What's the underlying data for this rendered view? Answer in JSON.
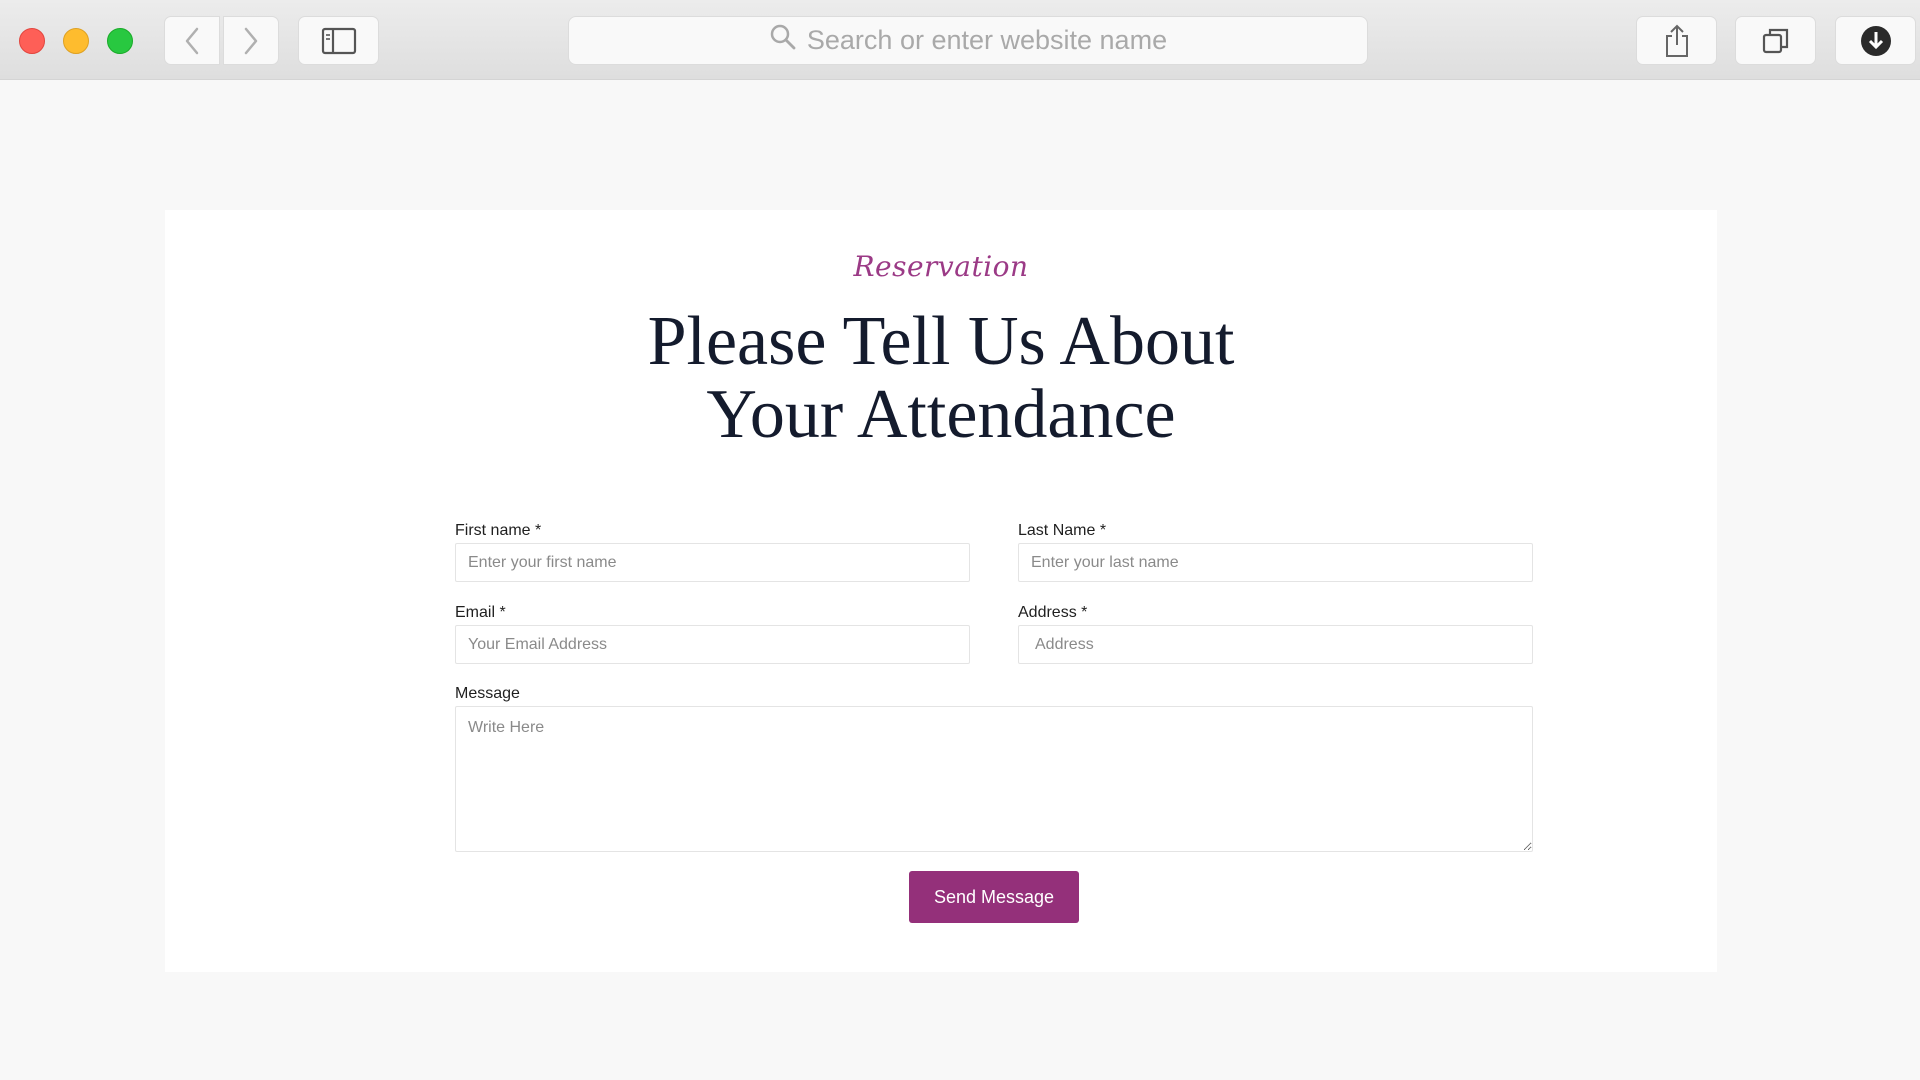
{
  "browser": {
    "address_placeholder": "Search or enter website name",
    "icons": {
      "back": "chevron-left-icon",
      "forward": "chevron-right-icon",
      "sidebar": "sidebar-icon",
      "search": "search-icon",
      "share": "share-icon",
      "tabs": "tabs-icon",
      "download": "download-icon"
    }
  },
  "form": {
    "kicker": "Reservation",
    "headline_line1": "Please Tell Us About",
    "headline_line2": "Your Attendance",
    "first_name": {
      "label": "First name *",
      "placeholder": "Enter your first name"
    },
    "last_name": {
      "label": "Last Name *",
      "placeholder": "Enter your last name"
    },
    "email": {
      "label": "Email *",
      "placeholder": "Your Email Address"
    },
    "address": {
      "label": "Address *",
      "placeholder": "Address"
    },
    "message": {
      "label": "Message",
      "placeholder": "Write Here"
    },
    "submit_label": "Send Message"
  },
  "colors": {
    "accent": "#94307a",
    "heading": "#141b2d",
    "page_bg": "#f8f8f8"
  }
}
